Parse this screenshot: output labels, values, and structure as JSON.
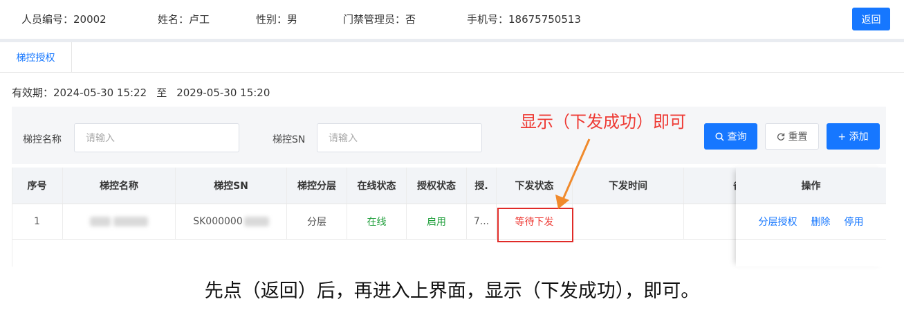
{
  "header": {
    "employee_id": "人员编号：20002",
    "name": "姓名：卢工",
    "gender": "性别：男",
    "door_admin": "门禁管理员：否",
    "phone": "手机号：18675750513",
    "back_label": "返回"
  },
  "tabs": [
    {
      "label": "梯控授权"
    }
  ],
  "validity": {
    "prefix": "有效期：",
    "start": "2024-05-30 15:22",
    "sep": "至",
    "end": "2029-05-30 15:20"
  },
  "search": {
    "name_label": "梯控名称",
    "name_placeholder": "请输入",
    "sn_label": "梯控SN",
    "sn_placeholder": "请输入",
    "query_label": "查询",
    "reset_label": "重置",
    "add_label": "+ 添加"
  },
  "annotation": {
    "text": "显示（下发成功）即可",
    "color": "#ee3a34"
  },
  "table": {
    "headers": {
      "index": "序号",
      "name": "梯控名称",
      "sn": "梯控SN",
      "floor": "梯控分层",
      "online": "在线状态",
      "auth": "授权状态",
      "auth2": "授.",
      "issue_status": "下发状态",
      "issue_time": "下发时间",
      "remark": "备",
      "ops": "操作"
    },
    "rows": [
      {
        "index": "1",
        "name": "",
        "sn": "SK000000",
        "floor": "分层",
        "online": "在线",
        "auth": "启用",
        "auth2": "7...",
        "issue_status": "等待下发",
        "issue_time": "",
        "remark": "",
        "op_floor_auth": "分层授权",
        "op_delete": "删除",
        "op_disable": "停用"
      }
    ]
  },
  "bottom_note": "先点（返回）后，再进入上界面，显示（下发成功），即可。",
  "colors": {
    "primary": "#1677ff",
    "green": "#1e9e3a",
    "red": "#ee3a34",
    "arrow": "#f08a2c"
  }
}
